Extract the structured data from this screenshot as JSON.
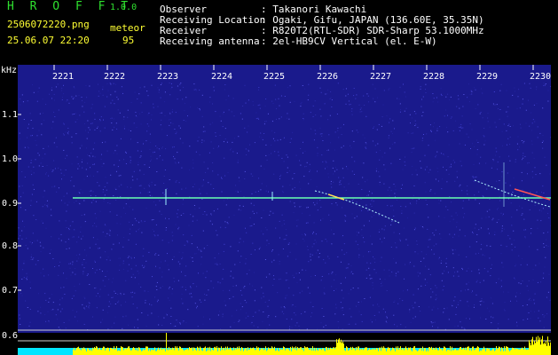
{
  "app": {
    "logo": "H R O F F T",
    "version": "1.0.0"
  },
  "file": {
    "name": "2506072220.png",
    "timestamp": "25.06.07 22:20"
  },
  "meteor": {
    "label": "meteor",
    "count": "95"
  },
  "info": [
    {
      "key": "Observer",
      "value": ": Takanori Kawachi"
    },
    {
      "key": "Receiving Location",
      "value": ": Ogaki, Gifu, JAPAN (136.60E, 35.35N)"
    },
    {
      "key": "Receiver",
      "value": ": R820T2(RTL-SDR) SDR-Sharp 53.1000MHz"
    },
    {
      "key": "Receiving antenna",
      "value": ": 2el-HB9CV Vertical (el. E-W)"
    }
  ],
  "axis": {
    "unit": "kHz",
    "time_labels": [
      "2221",
      "2222",
      "2223",
      "2224",
      "2225",
      "2226",
      "2227",
      "2228",
      "2229",
      "2230"
    ],
    "freq_labels": [
      "1.1",
      "1.0",
      "0.9",
      "0.8",
      "0.7",
      "0.6"
    ]
  },
  "colors": {
    "background": "#1a1a8c",
    "carrier": "#3cffc8",
    "level_bars": "#ffff00",
    "level_base": "#00e5ff",
    "text_green": "#2fe02f",
    "text_yellow": "#ffff33"
  }
}
